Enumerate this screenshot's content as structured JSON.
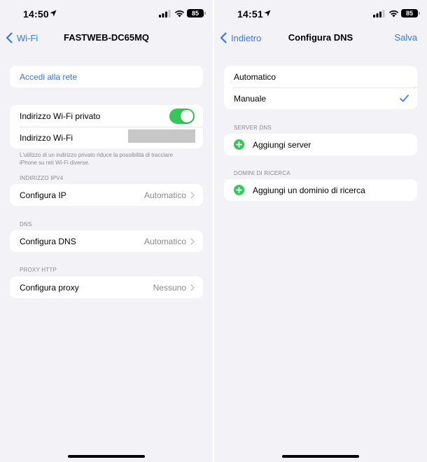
{
  "left": {
    "status": {
      "time": "14:50",
      "battery": "85"
    },
    "nav": {
      "back_label": "Wi-Fi",
      "title": "FASTWEB-DC65MQ"
    },
    "login_row": "Accedi alla rete",
    "private_address": {
      "label": "Indirizzo Wi-Fi privato",
      "toggle_on": true,
      "address_label": "Indirizzo Wi-Fi",
      "footnote": "L'utilizzo di un indirizzo privato riduce la possibilità di tracciare iPhone su reti Wi-Fi diverse."
    },
    "ipv4": {
      "header": "INDIRIZZO IPV4",
      "label": "Configura IP",
      "value": "Automatico"
    },
    "dns": {
      "header": "DNS",
      "label": "Configura DNS",
      "value": "Automatico"
    },
    "proxy": {
      "header": "PROXY HTTP",
      "label": "Configura proxy",
      "value": "Nessuno"
    }
  },
  "right": {
    "status": {
      "time": "14:51",
      "battery": "85"
    },
    "nav": {
      "back_label": "Indietro",
      "title": "Configura DNS",
      "save_label": "Salva"
    },
    "mode": {
      "options": [
        "Automatico",
        "Manuale"
      ],
      "selected": "Manuale"
    },
    "dns_servers": {
      "header": "SERVER DNS",
      "add_label": "Aggiungi server"
    },
    "search_domains": {
      "header": "DOMINI DI RICERCA",
      "add_label": "Aggiungi un dominio di ricerca"
    }
  },
  "colors": {
    "accent": "#3478f6",
    "toggle_on": "#34c759",
    "add_icon": "#34c759",
    "secondary_text": "#8a8a8e",
    "background": "#f2f2f7"
  },
  "icons": [
    "location-arrow-icon",
    "cellular-signal-icon",
    "wifi-icon",
    "battery-icon",
    "chevron-left-icon",
    "chevron-right-icon",
    "checkmark-icon",
    "add-circle-icon"
  ]
}
